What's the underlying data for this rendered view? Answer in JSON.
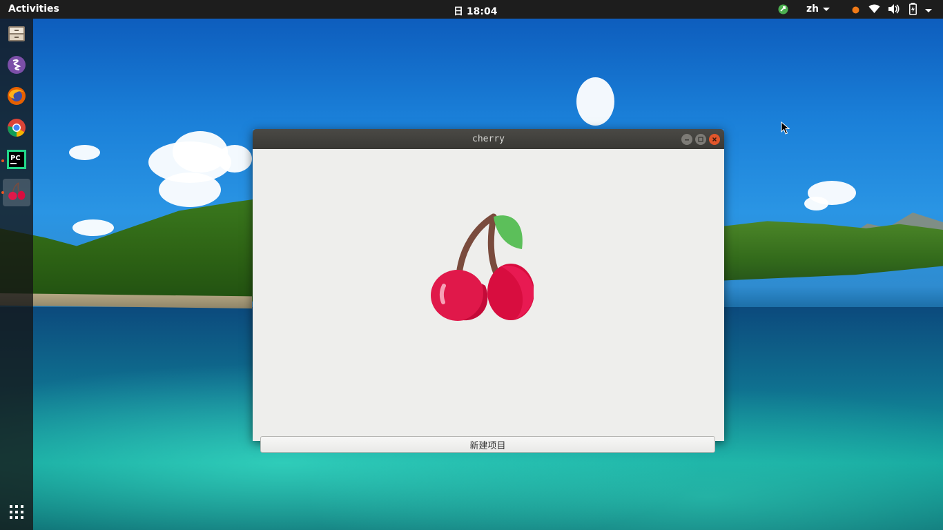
{
  "topbar": {
    "activities_label": "Activities",
    "clock": "日 18:04",
    "language": "zh",
    "tray_icons": [
      "app-indicator-icon",
      "notification-dot-icon",
      "wifi-icon",
      "volume-icon",
      "battery-icon",
      "system-menu-arrow-icon"
    ]
  },
  "dock": {
    "items": [
      {
        "name": "files",
        "icon": "file-cabinet-icon"
      },
      {
        "name": "emacs",
        "icon": "emacs-icon"
      },
      {
        "name": "firefox",
        "icon": "firefox-icon"
      },
      {
        "name": "chrome",
        "icon": "chrome-icon"
      },
      {
        "name": "pycharm",
        "icon": "pycharm-icon",
        "label": "PC"
      },
      {
        "name": "cherry",
        "icon": "cherry-icon",
        "active": true
      }
    ],
    "show_apps_icon": "app-grid-icon"
  },
  "window": {
    "title": "cherry",
    "button_label": "新建项目"
  },
  "colors": {
    "topbar": "#1d1d1d",
    "titlebar": "#3d3c38",
    "client": "#eeeeec",
    "close_button": "#e2562b",
    "cherry_red": "#e0184a",
    "leaf_green": "#5cbf5a",
    "stem": "#7a4b3d"
  }
}
